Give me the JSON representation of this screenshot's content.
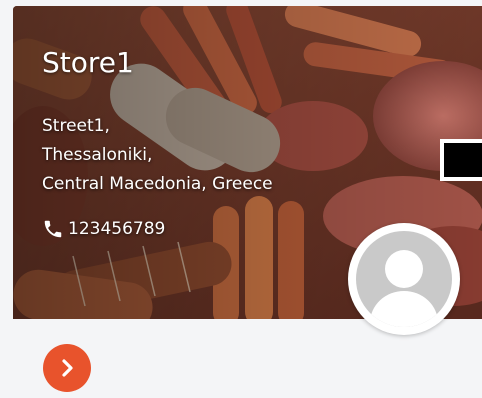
{
  "store": {
    "name": "Store1",
    "address": {
      "line1": "Street1,",
      "line2": "Thessaloniki,",
      "line3": "Central Macedonia, Greece"
    },
    "phone": "123456789"
  },
  "icons": {
    "phone": "phone-icon",
    "avatar": "user-placeholder-icon",
    "next": "chevron-right-icon"
  },
  "colors": {
    "accent": "#e8532c",
    "avatar_bg": "#c9c9c9",
    "card_bg": "#f4f5f7"
  }
}
